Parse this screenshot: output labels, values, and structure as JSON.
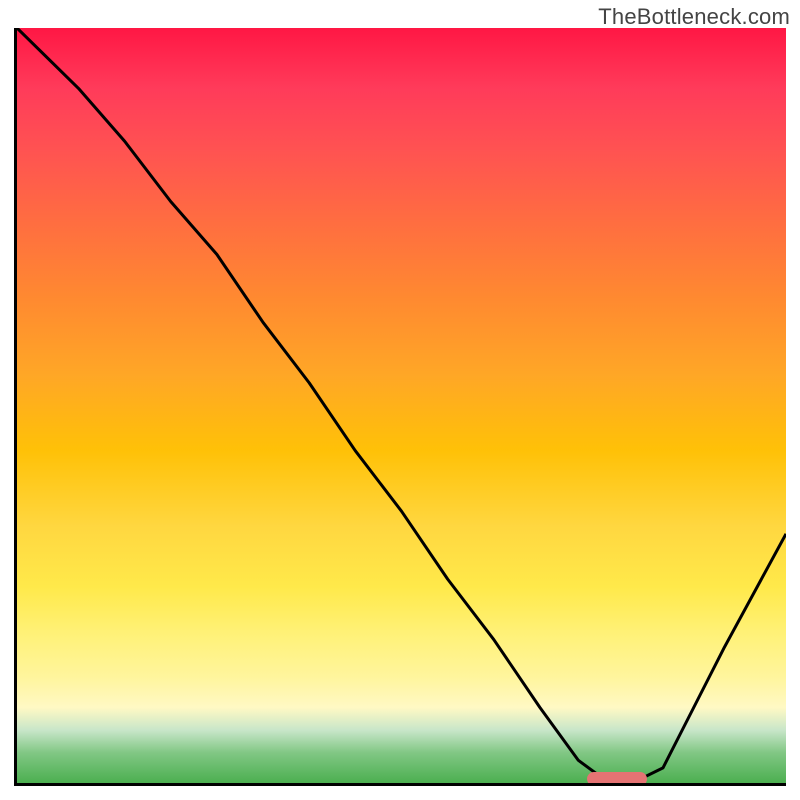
{
  "watermark": "TheBottleneck.com",
  "chart_data": {
    "type": "line",
    "title": "",
    "xlabel": "",
    "ylabel": "",
    "xlim": [
      0,
      100
    ],
    "ylim": [
      0,
      100
    ],
    "series": [
      {
        "name": "bottleneck-curve",
        "x": [
          0,
          8,
          14,
          20,
          26,
          32,
          38,
          44,
          50,
          56,
          62,
          68,
          73,
          77,
          80,
          84,
          88,
          92,
          100
        ],
        "y": [
          100,
          92,
          85,
          77,
          70,
          61,
          53,
          44,
          36,
          27,
          19,
          10,
          3,
          0,
          0,
          2,
          10,
          18,
          33
        ]
      }
    ],
    "marker": {
      "x": 78,
      "y": 0,
      "color": "#e57373"
    },
    "background_gradient": {
      "type": "vertical",
      "stops": [
        {
          "pct": 0,
          "color": "#ff1744"
        },
        {
          "pct": 26,
          "color": "#ff6e40"
        },
        {
          "pct": 56,
          "color": "#ffc107"
        },
        {
          "pct": 86,
          "color": "#fff59d"
        },
        {
          "pct": 100,
          "color": "#4caf50"
        }
      ]
    }
  }
}
